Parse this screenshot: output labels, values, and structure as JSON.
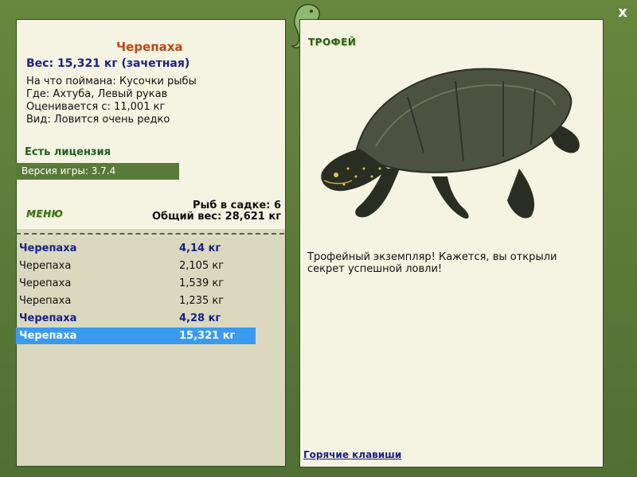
{
  "fish": {
    "title": "Черепаха",
    "weight": "Вес: 15,321 кг (зачетная)",
    "caught_on": "На что поймана: Кусочки рыбы",
    "where": "Где: Ахтуба, Левый рукав",
    "valued_from": "Оценивается с: 11,001 кг",
    "rarity": "Вид: Ловится очень редко"
  },
  "license": "Есть лицензия",
  "version": "Версия игры: 3.7.4",
  "menu_label": "МЕНЮ",
  "stats": {
    "in_cage": "Рыб в садке: 6",
    "total_weight": "Общий вес: 28,621 кг"
  },
  "catch_list": [
    {
      "name": "Черепаха",
      "weight": "4,14 кг"
    },
    {
      "name": "Черепаха",
      "weight": "2,105 кг"
    },
    {
      "name": "Черепаха",
      "weight": "1,539 кг"
    },
    {
      "name": "Черепаха",
      "weight": "1,235 кг"
    },
    {
      "name": "Черепаха",
      "weight": "4,28 кг"
    },
    {
      "name": "Черепаха",
      "weight": "15,321 кг"
    }
  ],
  "trophy_label": "ТРОФЕЙ",
  "trophy_text": "Трофейный экземпляр! Кажется, вы открыли секрет успешной ловли!",
  "hotkeys": "Горячие клавиши",
  "close_label": "x",
  "colors": {
    "frame_green": "#5a7a3a",
    "selected_row": "#3a9aef",
    "title_orange": "#c0461a",
    "bold_blue": "#1a1f86"
  }
}
